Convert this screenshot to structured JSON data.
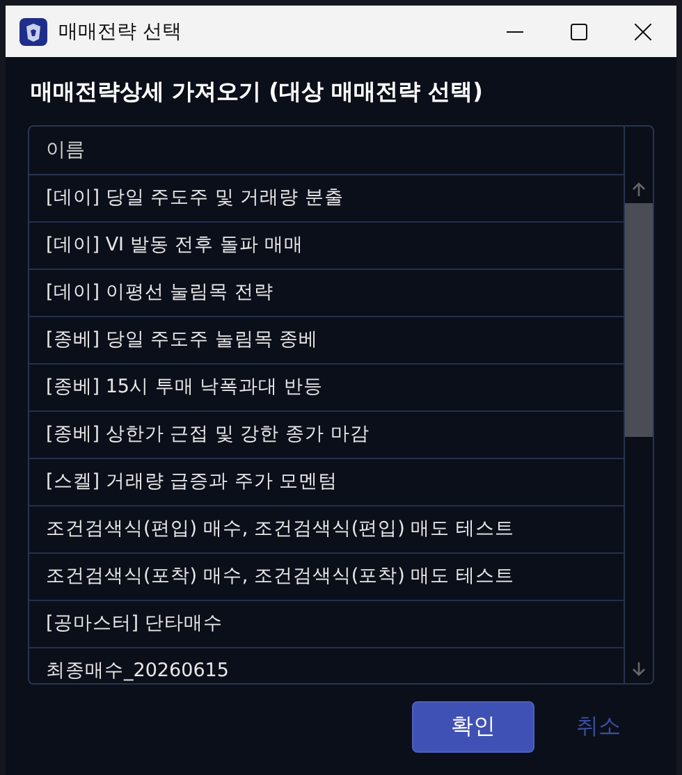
{
  "window": {
    "title": "매매전략 선택"
  },
  "heading": "매매전략상세 가져오기 (대상 매매전략 선택)",
  "table": {
    "columns": [
      "이름"
    ],
    "rows": [
      "[데이] 당일 주도주 및 거래량 분출",
      "[데이] VI 발동 전후 돌파 매매",
      "[데이] 이평선 눌림목 전략",
      "[종베] 당일 주도주 눌림목 종베",
      "[종베] 15시 투매 낙폭과대 반등",
      "[종베] 상한가 근접 및 강한 종가 마감",
      "[스켈] 거래량 급증과 주가 모멘텀",
      "조건검색식(편입) 매수,  조건검색식(편입) 매도 테스트",
      "조건검색식(포착) 매수,  조건검색식(포착) 매도 테스트",
      "[공마스터] 단타매수",
      "최종매수_20260615"
    ]
  },
  "buttons": {
    "confirm": "확인",
    "cancel": "취소"
  }
}
